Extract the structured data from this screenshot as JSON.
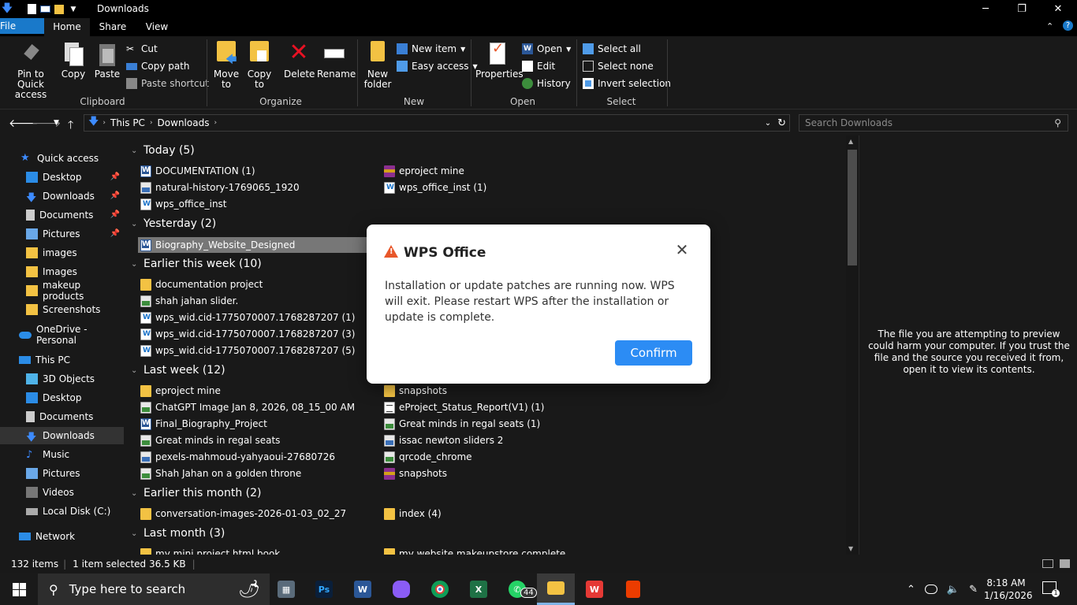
{
  "window": {
    "title": "Downloads",
    "minimize": "─",
    "restore": "❐",
    "close": "✕"
  },
  "tabs": [
    {
      "label": "File"
    },
    {
      "label": "Home"
    },
    {
      "label": "Share"
    },
    {
      "label": "View"
    }
  ],
  "ribbon": {
    "clipboard": {
      "label": "Clipboard",
      "pin": "Pin to Quick access",
      "copy": "Copy",
      "paste": "Paste",
      "cut": "Cut",
      "copy_path": "Copy path",
      "paste_shortcut": "Paste shortcut"
    },
    "organize": {
      "label": "Organize",
      "move_to": "Move to",
      "copy_to": "Copy to",
      "delete": "Delete",
      "rename": "Rename"
    },
    "new": {
      "label": "New",
      "new_folder": "New folder",
      "new_item": "New item",
      "easy_access": "Easy access"
    },
    "open": {
      "label": "Open",
      "properties": "Properties",
      "open": "Open",
      "edit": "Edit",
      "history": "History"
    },
    "select": {
      "label": "Select",
      "select_all": "Select all",
      "select_none": "Select none",
      "invert": "Invert selection"
    }
  },
  "address": {
    "crumbs": [
      "This PC",
      "Downloads"
    ],
    "search_placeholder": "Search Downloads"
  },
  "sidebar": {
    "quick_access": "Quick access",
    "items": [
      {
        "label": "Desktop"
      },
      {
        "label": "Downloads"
      },
      {
        "label": "Documents"
      },
      {
        "label": "Pictures"
      },
      {
        "label": "images"
      },
      {
        "label": "Images"
      },
      {
        "label": "makeup products"
      },
      {
        "label": "Screenshots"
      }
    ],
    "onedrive": "OneDrive - Personal",
    "this_pc": "This PC",
    "pc_items": [
      {
        "label": "3D Objects"
      },
      {
        "label": "Desktop"
      },
      {
        "label": "Documents"
      },
      {
        "label": "Downloads"
      },
      {
        "label": "Music"
      },
      {
        "label": "Pictures"
      },
      {
        "label": "Videos"
      },
      {
        "label": "Local Disk (C:)"
      }
    ],
    "network": "Network"
  },
  "groups": [
    {
      "title": "Today (5)",
      "files": [
        "DOCUMENTATION (1)",
        "eproject mine",
        "natural-history-1769065_1920",
        "wps_office_inst (1)",
        "wps_office_inst"
      ]
    },
    {
      "title": "Yesterday (2)",
      "files": [
        "Biography_Website_Designed"
      ]
    },
    {
      "title": "Earlier this week (10)",
      "files": [
        "documentation project",
        "shah jahan slider.",
        "wps_wid.cid-1775070007.1768287207 (1)",
        "wps_wid.cid-1775070007.1768287207 (3)",
        "wps_wid.cid-1775070007.1768287207 (5)"
      ]
    },
    {
      "title": "Last week (12)",
      "files": [
        "eproject mine",
        "snapshots",
        "ChatGPT Image Jan 8, 2026, 08_15_00 AM",
        "eProject_Status_Report(V1) (1)",
        "Final_Biography_Project",
        "Great minds in regal seats (1)",
        "Great minds in regal seats",
        "issac newton sliders 2",
        "pexels-mahmoud-yahyaoui-27680726",
        "qrcode_chrome",
        "Shah Jahan on a golden throne",
        "snapshots"
      ]
    },
    {
      "title": "Earlier this month (2)",
      "files": [
        "conversation-images-2026-01-03_02_27",
        "index (4)"
      ]
    },
    {
      "title": "Last month (3)",
      "files": [
        "my mini project html book",
        "my website makeupstore complete"
      ]
    }
  ],
  "preview": {
    "message": "The file you are attempting to preview could harm your computer. If you trust the file and the source you received it from, open it to view its contents."
  },
  "status": {
    "items": "132 items",
    "selected": "1 item selected  36.5 KB"
  },
  "dialog": {
    "title": "WPS Office",
    "message": "Installation or update patches are running now. WPS will exit. Please restart WPS after the installation or update is complete.",
    "confirm": "Confirm",
    "close": "✕"
  },
  "taskbar": {
    "search_placeholder": "Type here to search",
    "badge": "44",
    "time": "8:18 AM",
    "date": "1/16/2026"
  },
  "colors": {
    "accent": "#1979ca",
    "dialog_button": "#2c8cf4",
    "warning": "#e8572a",
    "folder": "#f3c243"
  }
}
